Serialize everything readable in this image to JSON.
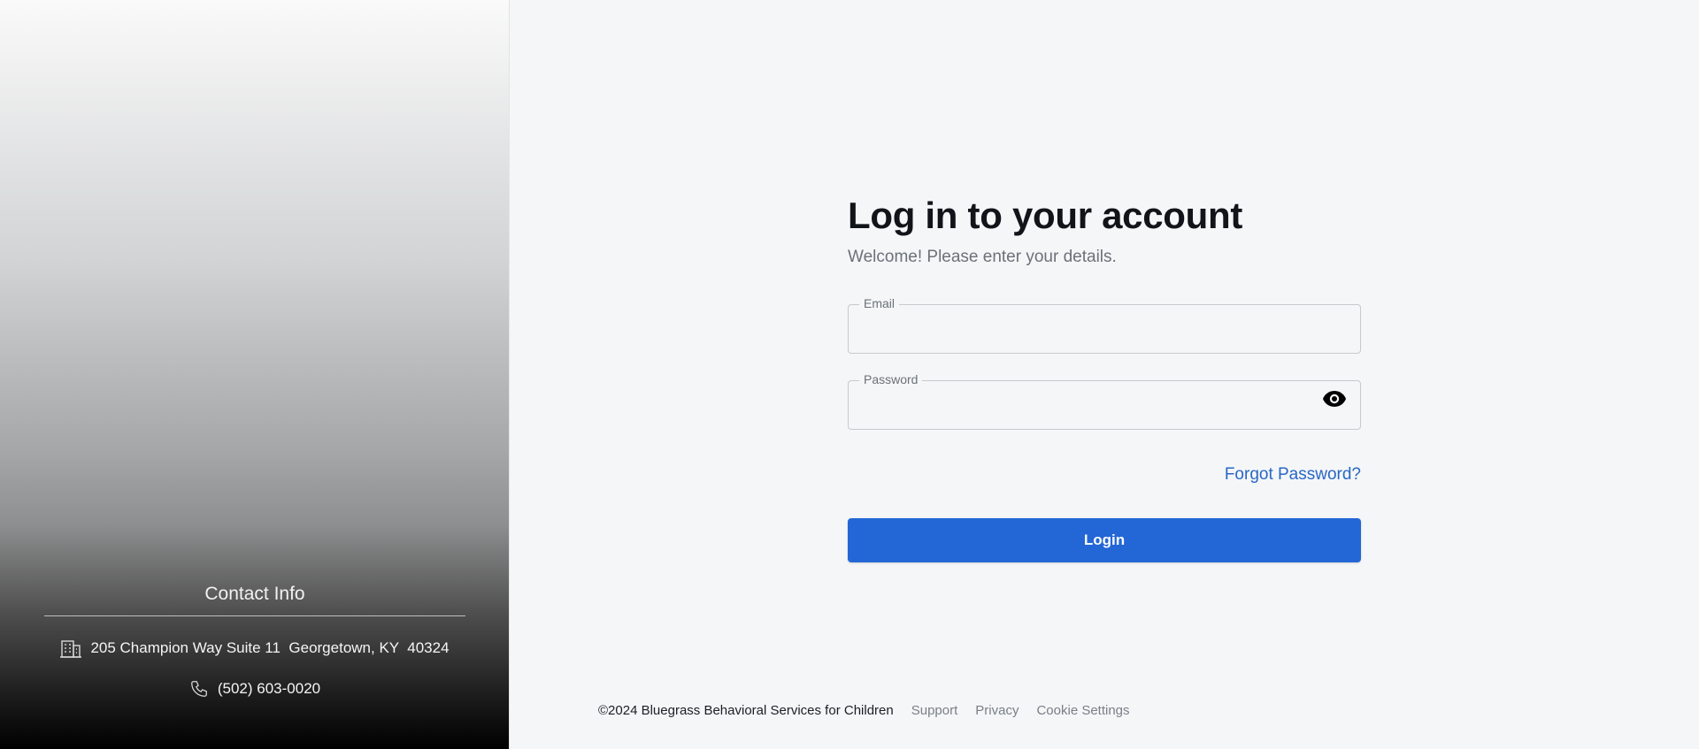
{
  "contact": {
    "title": "Contact Info",
    "address": "205 Champion Way Suite 11  Georgetown, KY  40324",
    "address_icon": "building-icon",
    "phone": "(502) 603-0020",
    "phone_icon": "phone-icon"
  },
  "login": {
    "heading": "Log in to your account",
    "subheading": "Welcome! Please enter your details.",
    "email_label": "Email",
    "email_value": "",
    "password_label": "Password",
    "password_value": "",
    "password_toggle_icon": "eye-icon",
    "forgot_link": "Forgot Password?",
    "login_button": "Login"
  },
  "footer": {
    "copyright": "©2024 Bluegrass Behavioral Services for Children",
    "links": [
      "Support",
      "Privacy",
      "Cookie Settings"
    ]
  },
  "colors": {
    "accent": "#2367d6",
    "link": "#2867c5",
    "background": "#f4f6f8"
  }
}
